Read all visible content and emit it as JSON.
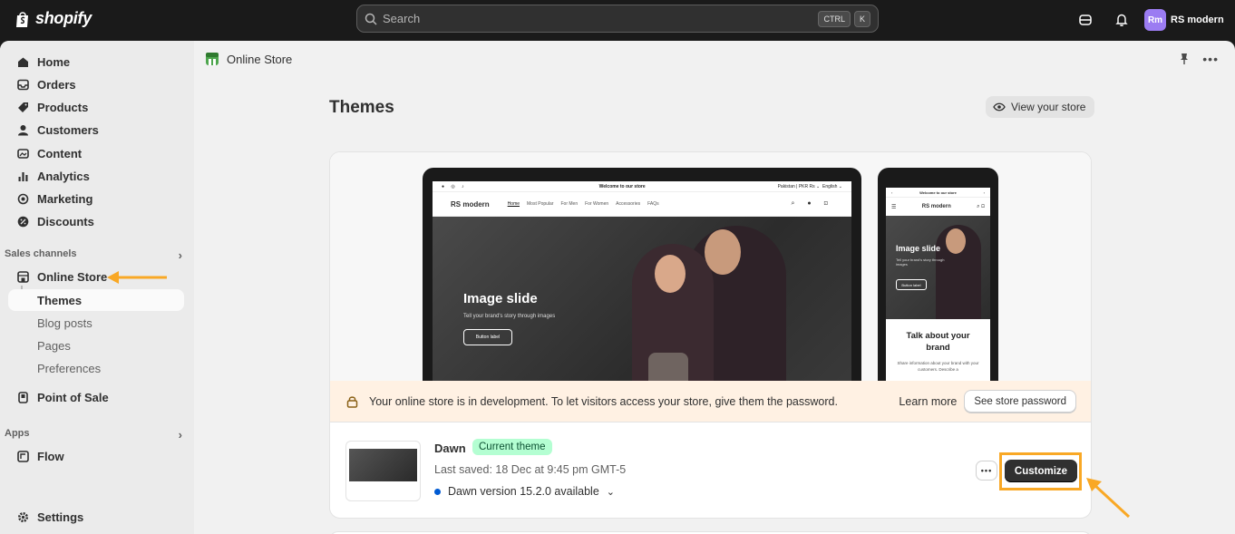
{
  "topbar": {
    "brand": "shopify",
    "search_placeholder": "Search",
    "shortcut_ctrl": "CTRL",
    "shortcut_key": "K",
    "avatar_initials": "Rm",
    "store_name": "RS modern"
  },
  "sidebar": {
    "items": [
      {
        "label": "Home",
        "icon": "home-icon"
      },
      {
        "label": "Orders",
        "icon": "inbox-icon"
      },
      {
        "label": "Products",
        "icon": "tag-icon"
      },
      {
        "label": "Customers",
        "icon": "person-icon"
      },
      {
        "label": "Content",
        "icon": "image-icon"
      },
      {
        "label": "Analytics",
        "icon": "chart-icon"
      },
      {
        "label": "Marketing",
        "icon": "target-icon"
      },
      {
        "label": "Discounts",
        "icon": "discount-icon"
      }
    ],
    "sales_channels_label": "Sales channels",
    "online_store": "Online Store",
    "sub_items": [
      "Themes",
      "Blog posts",
      "Pages",
      "Preferences"
    ],
    "point_of_sale": "Point of Sale",
    "apps_label": "Apps",
    "flow": "Flow",
    "settings": "Settings"
  },
  "breadcrumb": {
    "label": "Online Store"
  },
  "page": {
    "title": "Themes",
    "view_store": "View your store"
  },
  "preview": {
    "announcement": "Welcome to our store",
    "currency": "Pakistan | PKR Rs",
    "language": "English",
    "brand": "RS modern",
    "nav": [
      "Home",
      "Most Popular",
      "For Men",
      "For Women",
      "Accessories",
      "FAQs"
    ],
    "hero_title": "Image slide",
    "hero_sub": "Tell your brand's story through images",
    "hero_button": "Button label",
    "mobile_title": "Talk about your brand",
    "mobile_text": "Share information about your brand with your customers. Describe a"
  },
  "notice": {
    "text": "Your online store is in development. To let visitors access your store, give them the password.",
    "learn_more": "Learn more",
    "see_password": "See store password"
  },
  "theme": {
    "name": "Dawn",
    "badge": "Current theme",
    "saved": "Last saved: 18 Dec at 9:45 pm GMT-5",
    "version": "Dawn version 15.2.0 available",
    "customize": "Customize"
  },
  "colors": {
    "accent_arrow": "#f9a825",
    "badge_bg": "#b4fed2",
    "notice_bg": "#fff1e3"
  }
}
